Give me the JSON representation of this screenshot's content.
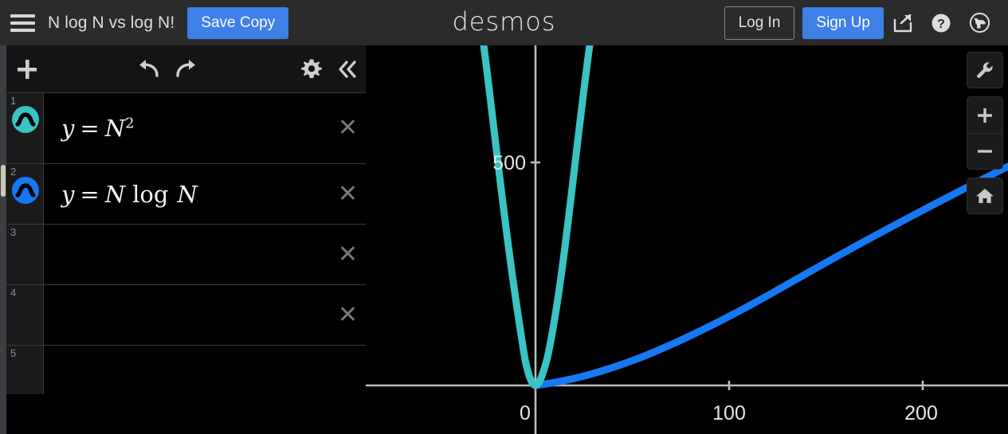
{
  "header": {
    "menu_icon": "hamburger-icon",
    "document_title": "N log N vs log N!",
    "save_copy_label": "Save Copy",
    "logo_text": "desmos",
    "login_label": "Log In",
    "signup_label": "Sign Up",
    "share_icon": "share-icon",
    "help_icon": "question-mark-icon",
    "language_icon": "globe-icon"
  },
  "toolbar": {
    "add_icon": "plus-icon",
    "undo_icon": "undo-arrow-icon",
    "redo_icon": "redo-arrow-icon",
    "settings_icon": "gear-icon",
    "collapse_icon": "double-chevron-left-icon"
  },
  "expressions": [
    {
      "index": "1",
      "math_lhs": "y",
      "math_eq": "=",
      "math_rhs_base": "N",
      "math_rhs_sup": "2",
      "color": "#3ac3c5",
      "close_label": "✕",
      "has_close": true
    },
    {
      "index": "2",
      "math_lhs": "y",
      "math_eq": "=",
      "math_rhs_base": "N",
      "math_rhs_fn": "log",
      "math_rhs_arg": "N",
      "color": "#1678f2",
      "close_label": "✕",
      "has_close": true
    },
    {
      "index": "3",
      "close_label": "✕",
      "has_close": true
    },
    {
      "index": "4",
      "close_label": "✕",
      "has_close": true
    },
    {
      "index": "5",
      "has_close": false
    }
  ],
  "graph_controls": {
    "tools_icon": "wrench-icon",
    "zoom_in_label": "+",
    "zoom_out_label": "−",
    "home_icon": "home-icon"
  },
  "chart_data": {
    "type": "line",
    "title": "N log N vs log N!",
    "xlabel": "",
    "ylabel": "",
    "xlim": [
      -85,
      230
    ],
    "ylim": [
      -25,
      1100
    ],
    "x_ticks": [
      0,
      100,
      200
    ],
    "x_tick_labels": [
      "0",
      "100",
      "200"
    ],
    "y_ticks": [
      500
    ],
    "y_tick_labels": [
      "500"
    ],
    "grid": false,
    "axis_color": "#bcbcbc",
    "background": "#000000",
    "series": [
      {
        "name": "y = N^2",
        "color": "#3ac3c5",
        "formula": "y = N^2",
        "x": [
          -33,
          -25,
          -20,
          -15,
          -10,
          -5,
          0,
          5,
          10,
          15,
          20,
          25,
          33
        ],
        "y": [
          1089,
          625,
          400,
          225,
          100,
          25,
          0,
          25,
          100,
          225,
          400,
          625,
          1089
        ]
      },
      {
        "name": "y = N log N",
        "color": "#1678f2",
        "formula": "y = N log N",
        "x": [
          0,
          10,
          25,
          50,
          75,
          100,
          125,
          150,
          175,
          200,
          225
        ],
        "y": [
          0,
          10,
          35,
          85,
          141,
          200,
          262,
          326,
          392,
          460,
          530
        ]
      }
    ]
  }
}
